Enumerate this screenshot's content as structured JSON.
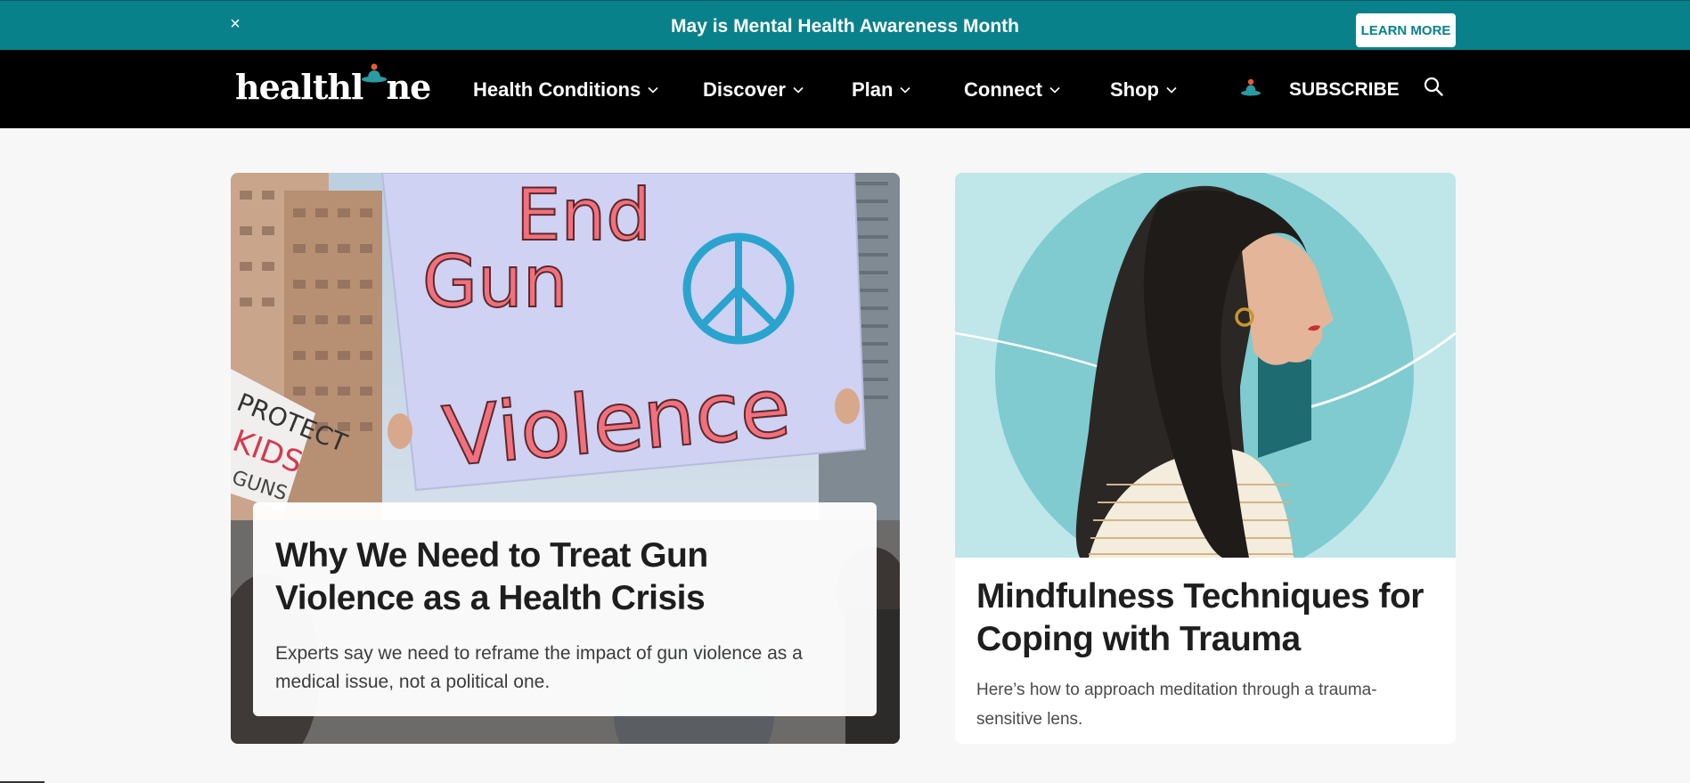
{
  "promo": {
    "close_glyph": "×",
    "text": "May is Mental Health Awareness Month",
    "button_label": "LEARN MORE",
    "bg_color": "#08818a"
  },
  "nav": {
    "logo_text_left": "healthl",
    "logo_text_right": "ne",
    "items": [
      {
        "label": "Health Conditions",
        "icon": "chevron-down-icon"
      },
      {
        "label": "Discover",
        "icon": "chevron-down-icon"
      },
      {
        "label": "Plan",
        "icon": "chevron-down-icon"
      },
      {
        "label": "Connect",
        "icon": "chevron-down-icon"
      },
      {
        "label": "Shop",
        "icon": "chevron-down-icon"
      }
    ],
    "subscribe_icon": "meditating-figure-icon",
    "subscribe_label": "SUBSCRIBE",
    "search_icon": "search-icon"
  },
  "feature_left": {
    "image_sign_words": [
      "End",
      "Gun",
      "Violence"
    ],
    "image_side_sign_words": [
      "PROTECT",
      "KIDS",
      "GUNS"
    ],
    "title": "Why We Need to Treat Gun Violence as a Health Crisis",
    "description": "Experts say we need to reframe the impact of gun violence as a medical issue, not a political one."
  },
  "feature_right": {
    "title": "Mindfulness Techniques for Coping with Trauma",
    "description": "Here’s how to approach meditation through a trauma-sensitive lens."
  }
}
